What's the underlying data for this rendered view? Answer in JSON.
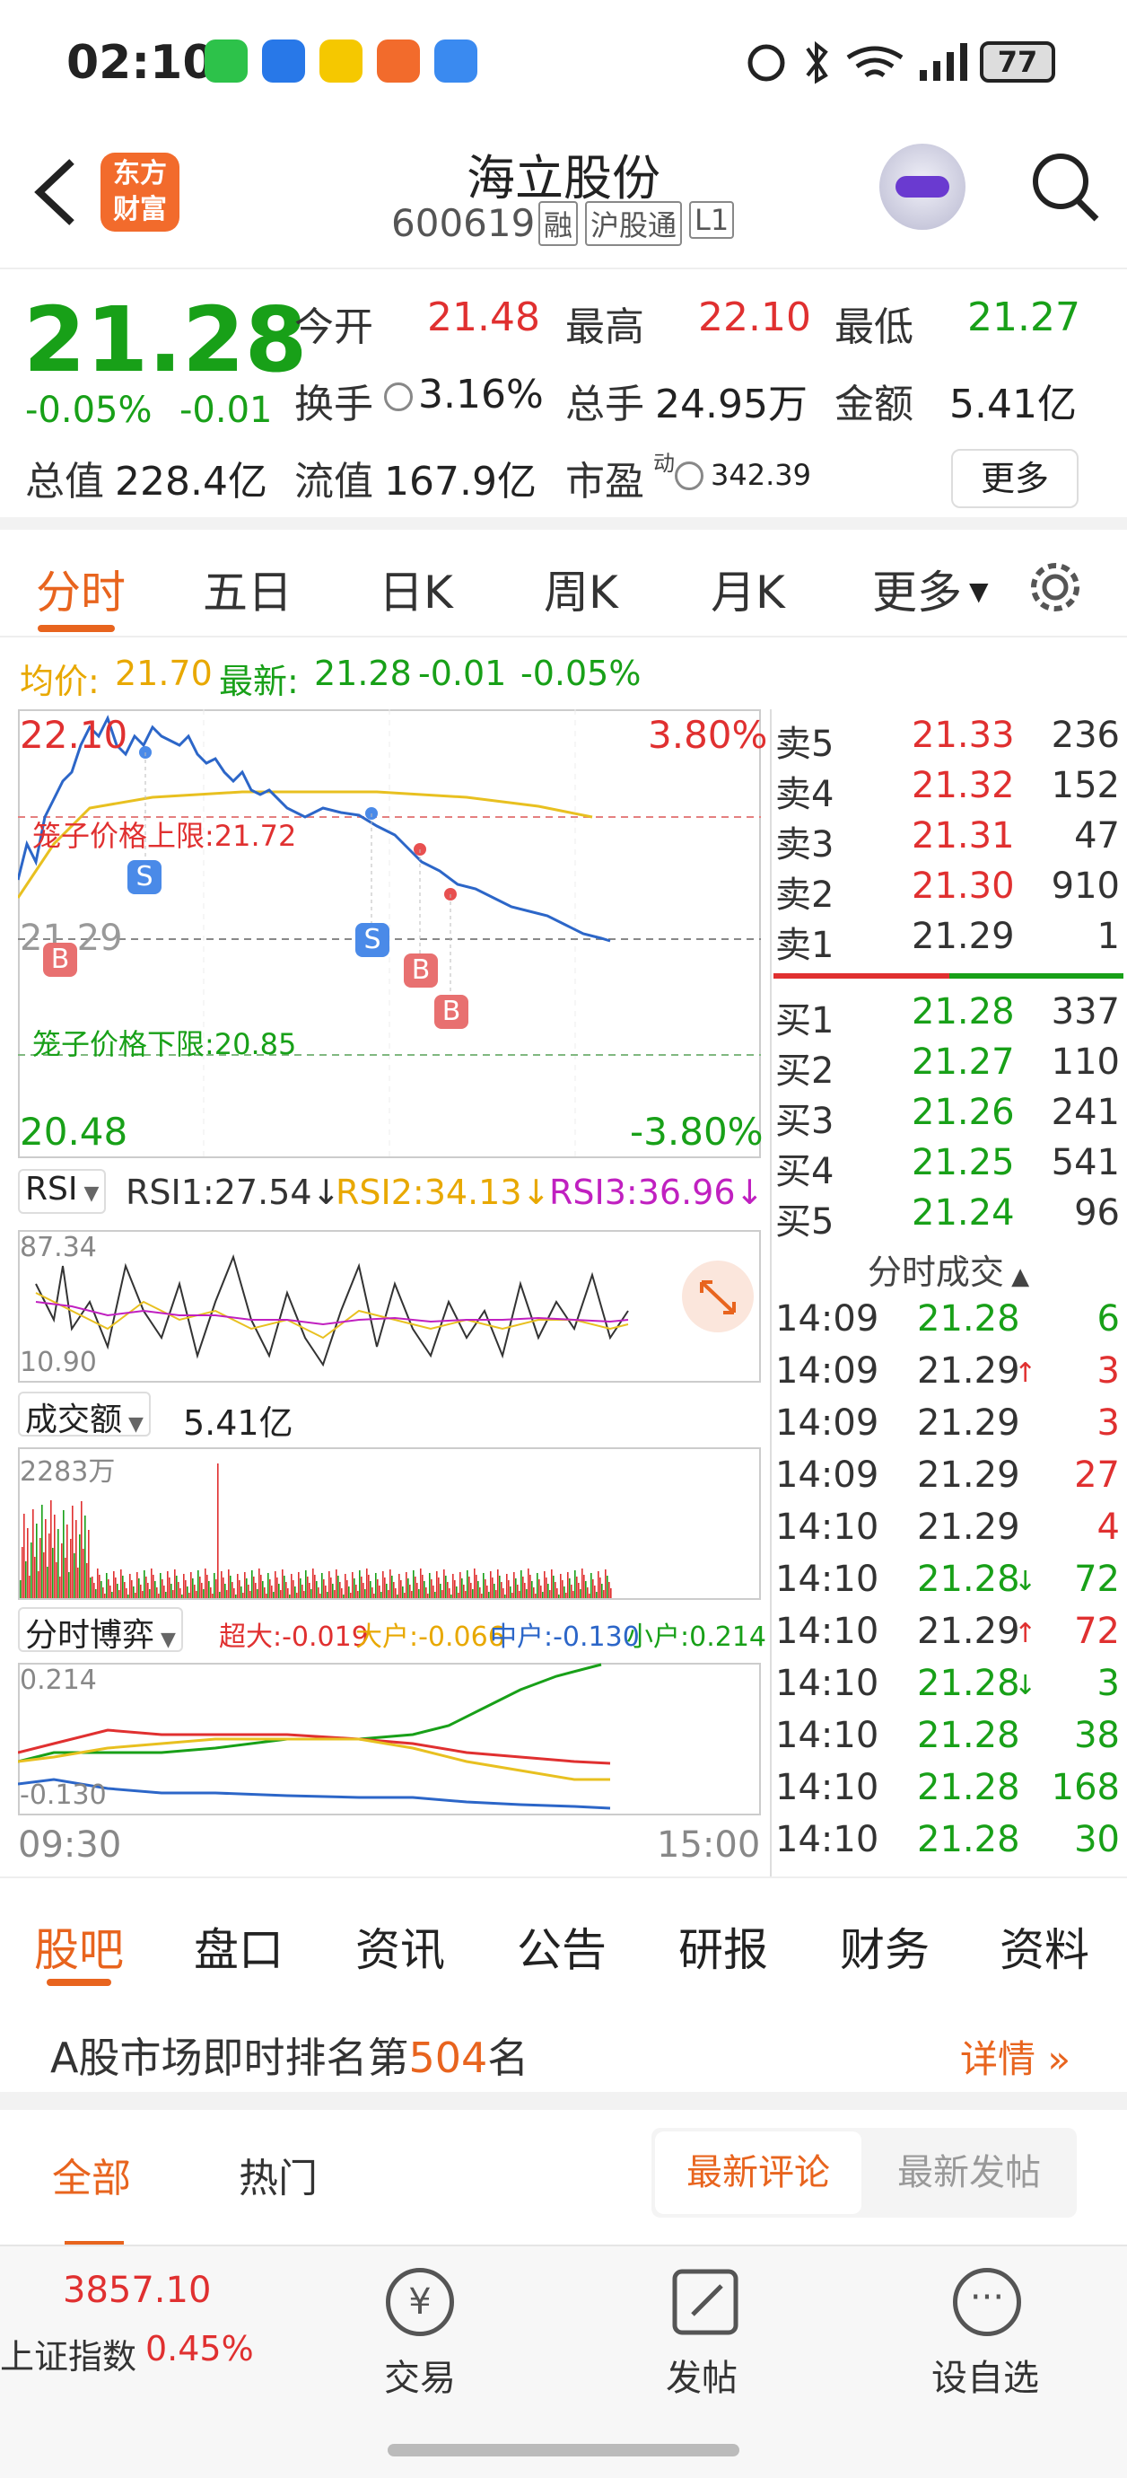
{
  "status_bar": {
    "time": "02:10",
    "battery": "77"
  },
  "header": {
    "logo_line1": "东方",
    "logo_line2": "财富",
    "stock_name": "海立股份",
    "stock_code": "600619",
    "badges": [
      "融",
      "沪股通",
      "L1"
    ]
  },
  "quote": {
    "price": "21.28",
    "change_pct": "-0.05%",
    "change": "-0.01",
    "open_label": "今开",
    "open": "21.48",
    "high_label": "最高",
    "high": "22.10",
    "low_label": "最低",
    "low": "21.27",
    "turnover_label": "换手",
    "turnover": "3.16%",
    "volume_label": "总手",
    "volume": "24.95万",
    "amount_label": "金额",
    "amount": "5.41亿",
    "mktcap_label": "总值",
    "mktcap": "228.4亿",
    "float_label": "流值",
    "float": "167.9亿",
    "pe_label": "市盈",
    "pe_sup": "动",
    "pe": "342.39",
    "more_button": "更多"
  },
  "chart_tabs": [
    "分时",
    "五日",
    "日K",
    "周K",
    "月K",
    "更多"
  ],
  "avg_line": {
    "avg_label": "均价:",
    "avg_value": "21.70",
    "latest_label": "最新:",
    "latest_value": "21.28",
    "latest_change": "-0.01",
    "latest_pct": "-0.05%"
  },
  "chart_labels": {
    "top_price": "22.10",
    "top_pct": "3.80%",
    "bottom_price": "20.48",
    "bottom_pct": "-3.80%",
    "mid_price": "21.29",
    "cage_upper": "笼子价格上限:21.72",
    "cage_lower": "笼子价格下限:20.85",
    "markers": [
      "S",
      "B",
      "S",
      "B",
      "B"
    ]
  },
  "rsi": {
    "selector": "RSI",
    "rsi1": "RSI1:27.54↓",
    "rsi2": "RSI2:34.13↓",
    "rsi3": "RSI3:36.96↓",
    "top": "87.34",
    "bottom": "10.90"
  },
  "volume_panel": {
    "selector": "成交额",
    "total": "5.41亿",
    "max_label": "2283万"
  },
  "game_panel": {
    "selector": "分时博弈",
    "super": "超大:-0.019",
    "large": "大户:-0.066",
    "medium": "中户:-0.130",
    "small": "小户:0.214",
    "top": "0.214",
    "bottom": "-0.130",
    "time_start": "09:30",
    "time_end": "15:00"
  },
  "asks": [
    {
      "label": "卖5",
      "price": "21.33",
      "vol": "236"
    },
    {
      "label": "卖4",
      "price": "21.32",
      "vol": "152"
    },
    {
      "label": "卖3",
      "price": "21.31",
      "vol": "47"
    },
    {
      "label": "卖2",
      "price": "21.30",
      "vol": "910"
    },
    {
      "label": "卖1",
      "price": "21.29",
      "vol": "1"
    }
  ],
  "bids": [
    {
      "label": "买1",
      "price": "21.28",
      "vol": "337"
    },
    {
      "label": "买2",
      "price": "21.27",
      "vol": "110"
    },
    {
      "label": "买3",
      "price": "21.26",
      "vol": "241"
    },
    {
      "label": "买4",
      "price": "21.25",
      "vol": "541"
    },
    {
      "label": "买5",
      "price": "21.24",
      "vol": "96"
    }
  ],
  "trades_title": "分时成交",
  "trades": [
    {
      "time": "14:09",
      "price": "21.28",
      "arrow": "",
      "vol": "6"
    },
    {
      "time": "14:09",
      "price": "21.29",
      "arrow": "↑",
      "vol": "3"
    },
    {
      "time": "14:09",
      "price": "21.29",
      "arrow": "",
      "vol": "3"
    },
    {
      "time": "14:09",
      "price": "21.29",
      "arrow": "",
      "vol": "27"
    },
    {
      "time": "14:10",
      "price": "21.29",
      "arrow": "",
      "vol": "4"
    },
    {
      "time": "14:10",
      "price": "21.28",
      "arrow": "↓",
      "vol": "72"
    },
    {
      "time": "14:10",
      "price": "21.29",
      "arrow": "↑",
      "vol": "72"
    },
    {
      "time": "14:10",
      "price": "21.28",
      "arrow": "↓",
      "vol": "3"
    },
    {
      "time": "14:10",
      "price": "21.28",
      "arrow": "",
      "vol": "38"
    },
    {
      "time": "14:10",
      "price": "21.28",
      "arrow": "",
      "vol": "168"
    },
    {
      "time": "14:10",
      "price": "21.28",
      "arrow": "",
      "vol": "30"
    }
  ],
  "bottom_tabs": [
    "股吧",
    "盘口",
    "资讯",
    "公告",
    "研报",
    "财务",
    "资料"
  ],
  "rank": {
    "prefix": "A股市场即时排名第",
    "number": "504",
    "suffix": "名",
    "detail": "详情"
  },
  "sub_tabs": {
    "all": "全部",
    "hot": "热门",
    "latest_comment": "最新评论",
    "latest_post": "最新发帖"
  },
  "bottom_nav": {
    "index_value": "3857.10",
    "index_name": "上证指数",
    "index_pct": "0.45%",
    "trade": "交易",
    "post": "发帖",
    "watchlist": "设自选"
  },
  "colors": {
    "up": "#e03030",
    "down": "#18a018",
    "accent": "#e8641e",
    "price_line": "#2c66c8",
    "avg_line": "#e8c020"
  }
}
